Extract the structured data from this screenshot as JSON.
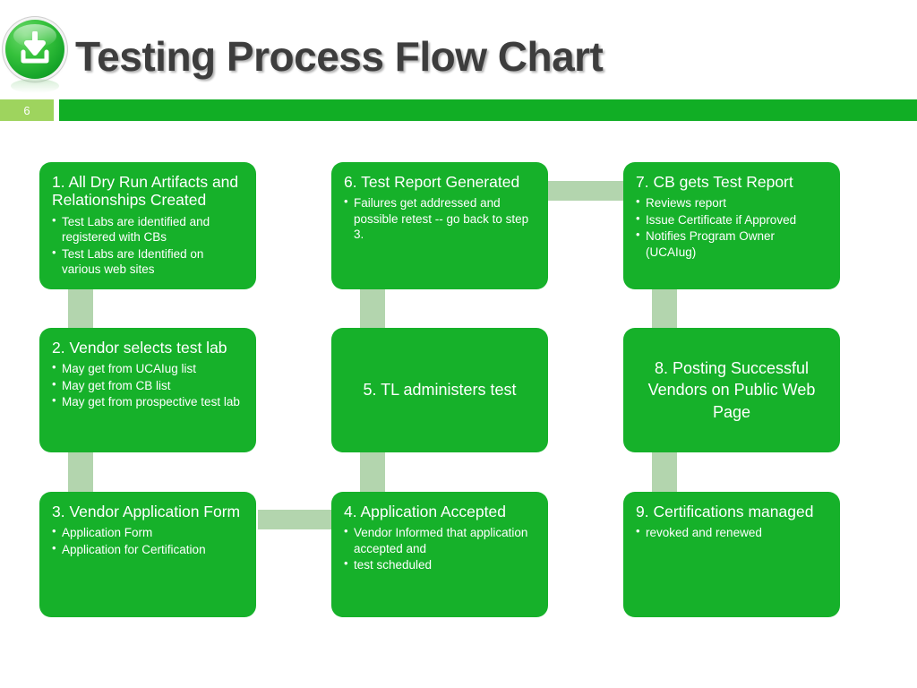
{
  "header": {
    "title": "Testing Process Flow Chart",
    "icon": "download-icon",
    "slide_number": "6",
    "badge_color": "#9ed45e",
    "bar_color": "#11ae25",
    "title_color": "#3d3d3d"
  },
  "theme": {
    "node_fill": "#16b12a",
    "connector_fill": "#b3d5ae",
    "node_text": "#ffffff"
  },
  "flow": {
    "nodes": [
      {
        "id": "node-1",
        "title": "1. All Dry Run Artifacts and Relationships Created",
        "bullets": [
          "Test Labs are identified and registered with CBs",
          "Test Labs are Identified on various web sites"
        ],
        "align": "left"
      },
      {
        "id": "node-2",
        "title": "2. Vendor selects test lab",
        "bullets": [
          "May get from UCAIug list",
          "May get from CB list",
          "May get from prospective test lab"
        ],
        "align": "left"
      },
      {
        "id": "node-3",
        "title": "3. Vendor Application Form",
        "bullets": [
          "Application Form",
          "Application for Certification"
        ],
        "align": "left"
      },
      {
        "id": "node-4",
        "title": "4. Application Accepted",
        "bullets": [
          "Vendor Informed that application accepted and",
          "test scheduled"
        ],
        "align": "left"
      },
      {
        "id": "node-5",
        "title": "5. TL administers test",
        "bullets": [],
        "align": "center"
      },
      {
        "id": "node-6",
        "title": "6. Test Report Generated",
        "bullets": [
          "Failures get addressed and possible retest -- go back to step 3."
        ],
        "align": "left"
      },
      {
        "id": "node-7",
        "title": "7. CB gets Test Report",
        "bullets": [
          "Reviews report",
          "Issue Certificate if Approved",
          "Notifies Program Owner (UCAIug)"
        ],
        "align": "left"
      },
      {
        "id": "node-8",
        "title": "8. Posting Successful Vendors on Public Web Page",
        "bullets": [],
        "align": "center"
      },
      {
        "id": "node-9",
        "title": "9. Certifications managed",
        "bullets": [
          "revoked and renewed"
        ],
        "align": "left"
      }
    ],
    "connectors": [
      {
        "id": "connector-1-2",
        "from": "node-1",
        "to": "node-2",
        "orientation": "vertical"
      },
      {
        "id": "connector-2-3",
        "from": "node-2",
        "to": "node-3",
        "orientation": "vertical"
      },
      {
        "id": "connector-3-4",
        "from": "node-3",
        "to": "node-4",
        "orientation": "horizontal"
      },
      {
        "id": "connector-4-5",
        "from": "node-4",
        "to": "node-5",
        "orientation": "vertical"
      },
      {
        "id": "connector-5-6",
        "from": "node-5",
        "to": "node-6",
        "orientation": "vertical"
      },
      {
        "id": "connector-6-7",
        "from": "node-6",
        "to": "node-7",
        "orientation": "horizontal"
      },
      {
        "id": "connector-7-8",
        "from": "node-7",
        "to": "node-8",
        "orientation": "vertical"
      },
      {
        "id": "connector-8-9",
        "from": "node-8",
        "to": "node-9",
        "orientation": "vertical"
      }
    ]
  }
}
